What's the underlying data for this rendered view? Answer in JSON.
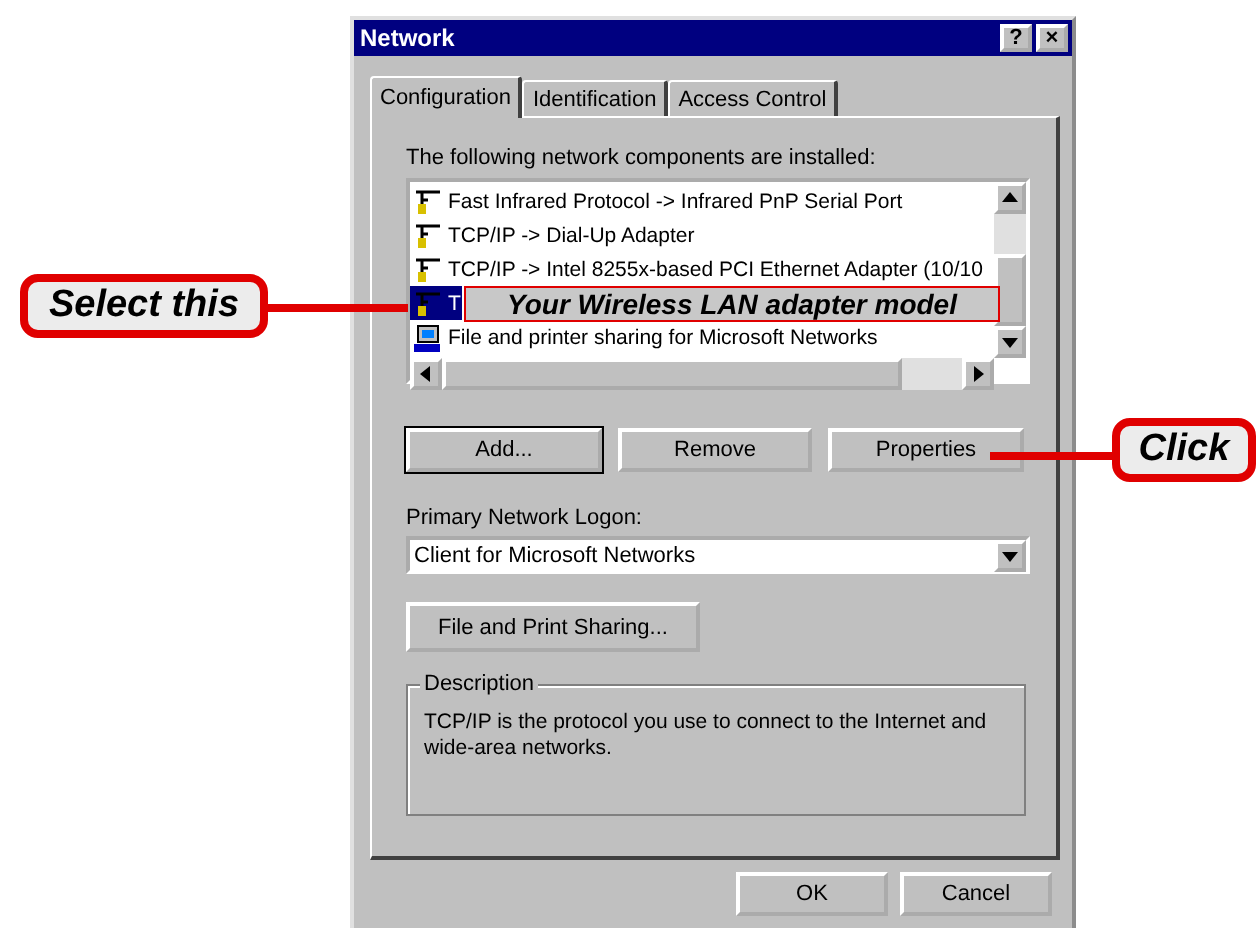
{
  "window": {
    "title": "Network",
    "help_button": "?",
    "close_button": "×"
  },
  "tabs": [
    {
      "label": "Configuration",
      "selected": true
    },
    {
      "label": "Identification",
      "selected": false
    },
    {
      "label": "Access Control",
      "selected": false
    }
  ],
  "components_label": "The following network components are installed:",
  "components": [
    {
      "label": "Fast Infrared Protocol -> Infrared PnP Serial Port",
      "kind": "protocol",
      "selected": false
    },
    {
      "label": "TCP/IP -> Dial-Up Adapter",
      "kind": "protocol",
      "selected": false
    },
    {
      "label": "TCP/IP -> Intel 8255x-based PCI Ethernet Adapter (10/10",
      "kind": "protocol",
      "selected": false
    },
    {
      "label": "T",
      "kind": "protocol",
      "selected": true
    },
    {
      "label": "File and printer sharing for Microsoft Networks",
      "kind": "service",
      "selected": false
    }
  ],
  "buttons": [
    "Add...",
    "Remove",
    "Properties"
  ],
  "logon": {
    "label": "Primary Network Logon:",
    "value": "Client for Microsoft Networks"
  },
  "sharing_button": "File and Print Sharing...",
  "description": {
    "title": "Description",
    "text": "TCP/IP is the protocol you use to connect to the Internet and wide-area networks."
  },
  "footer_buttons": [
    "OK",
    "Cancel"
  ],
  "annotations": {
    "row_overlay": "Your Wireless LAN adapter model",
    "select_callout": "Select this",
    "click_callout": "Click"
  }
}
